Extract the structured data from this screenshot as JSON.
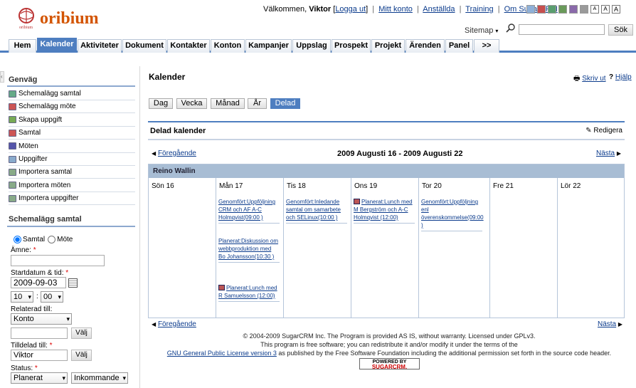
{
  "brand": {
    "logo_text": "oribium"
  },
  "userbar": {
    "welcome": "Välkommen,",
    "user": "Viktor",
    "logout": "Logga ut",
    "links": [
      "Mitt konto",
      "Anställda",
      "Training",
      "Om SugarCRM"
    ]
  },
  "themes": {
    "colors": [
      "#8fb0d8",
      "#c74f4f",
      "#5a9e6f",
      "#6a9a5a",
      "#8a6aaa",
      "#9a9a9a"
    ],
    "font_sizes": [
      "A",
      "A",
      "A"
    ]
  },
  "search": {
    "sitemap": "Sitemap",
    "button": "Sök",
    "placeholder": ""
  },
  "nav": {
    "tabs": [
      "Hem",
      "Kalender",
      "Aktiviteter",
      "Dokument",
      "Kontakter",
      "Konton",
      "Kampanjer",
      "Uppslag",
      "Prospekt",
      "Projekt",
      "Ärenden",
      "Panel",
      ">>"
    ],
    "active": "Kalender"
  },
  "sidebar": {
    "shortcuts_title": "Genväg",
    "shortcuts": [
      "Schemalägg samtal",
      "Schemalägg möte",
      "Skapa uppgift",
      "Samtal",
      "Möten",
      "Uppgifter",
      "Importera samtal",
      "Importera möten",
      "Importera uppgifter"
    ],
    "form_title": "Schemalägg samtal",
    "radio_call": "Samtal",
    "radio_meeting": "Möte",
    "subject_label": "Ämne:",
    "start_label": "Startdatum & tid:",
    "start_date": "2009-09-03",
    "hour": "10",
    "minute": "00",
    "related_label": "Relaterad till:",
    "related_value": "Konto",
    "choose": "Välj",
    "assigned_label": "Tilldelad till:",
    "assigned_value": "Viktor",
    "status_label": "Status:",
    "status_value": "Planerat",
    "direction_value": "Inkommande"
  },
  "main": {
    "title": "Kalender",
    "print": "Skriv ut",
    "help": "Hjälp",
    "views": [
      "Dag",
      "Vecka",
      "Månad",
      "År",
      "Delad"
    ],
    "active_view": "Delad",
    "shared_title": "Delad kalender",
    "edit": "Redigera",
    "prev": "Föregående",
    "next": "Nästa",
    "range": "2009 Augusti 16 - 2009 Augusti 22",
    "user_row": "Reino Wallin",
    "days": [
      {
        "label": "Sön 16",
        "events": []
      },
      {
        "label": "Mån 17",
        "events": [
          {
            "text": "Genomfört:Uppföljning CRM och AF A-C Holmqvist(09:00 )",
            "icon": false
          },
          {
            "text": "Planerat:Diskussion om webbproduktion med Bo Johansson(10:30 )",
            "icon": false
          },
          {
            "text": "Planerat:Lunch med R Samuelsson (12:00)",
            "icon": true
          }
        ]
      },
      {
        "label": "Tis 18",
        "events": [
          {
            "text": "Genomfört:Inledande samtal om samarbete och SELinux(10:00 )",
            "icon": false
          }
        ]
      },
      {
        "label": "Ons 19",
        "events": [
          {
            "text": "Planerat:Lunch med M Bergström och A-C Holmqvist (12:00)",
            "icon": true
          }
        ]
      },
      {
        "label": "Tor 20",
        "events": [
          {
            "text": "Genomfört:Uppföljning enl överenskommelse(09:00 )",
            "icon": false
          }
        ]
      },
      {
        "label": "Fre 21",
        "events": []
      },
      {
        "label": "Lör 22",
        "events": []
      }
    ]
  },
  "footer": {
    "line1": "© 2004-2009 SugarCRM Inc. The Program is provided AS IS, without warranty. Licensed under GPLv3.",
    "line2": "This program is free software; you can redistribute it and/or modify it under the terms of the",
    "line3_link": "GNU General Public License version 3",
    "line3_rest": "as published by the Free Software Foundation including the additional permission set forth in the source code header.",
    "powered_top": "POWERED BY",
    "powered_brand": "SUGARCRM."
  }
}
